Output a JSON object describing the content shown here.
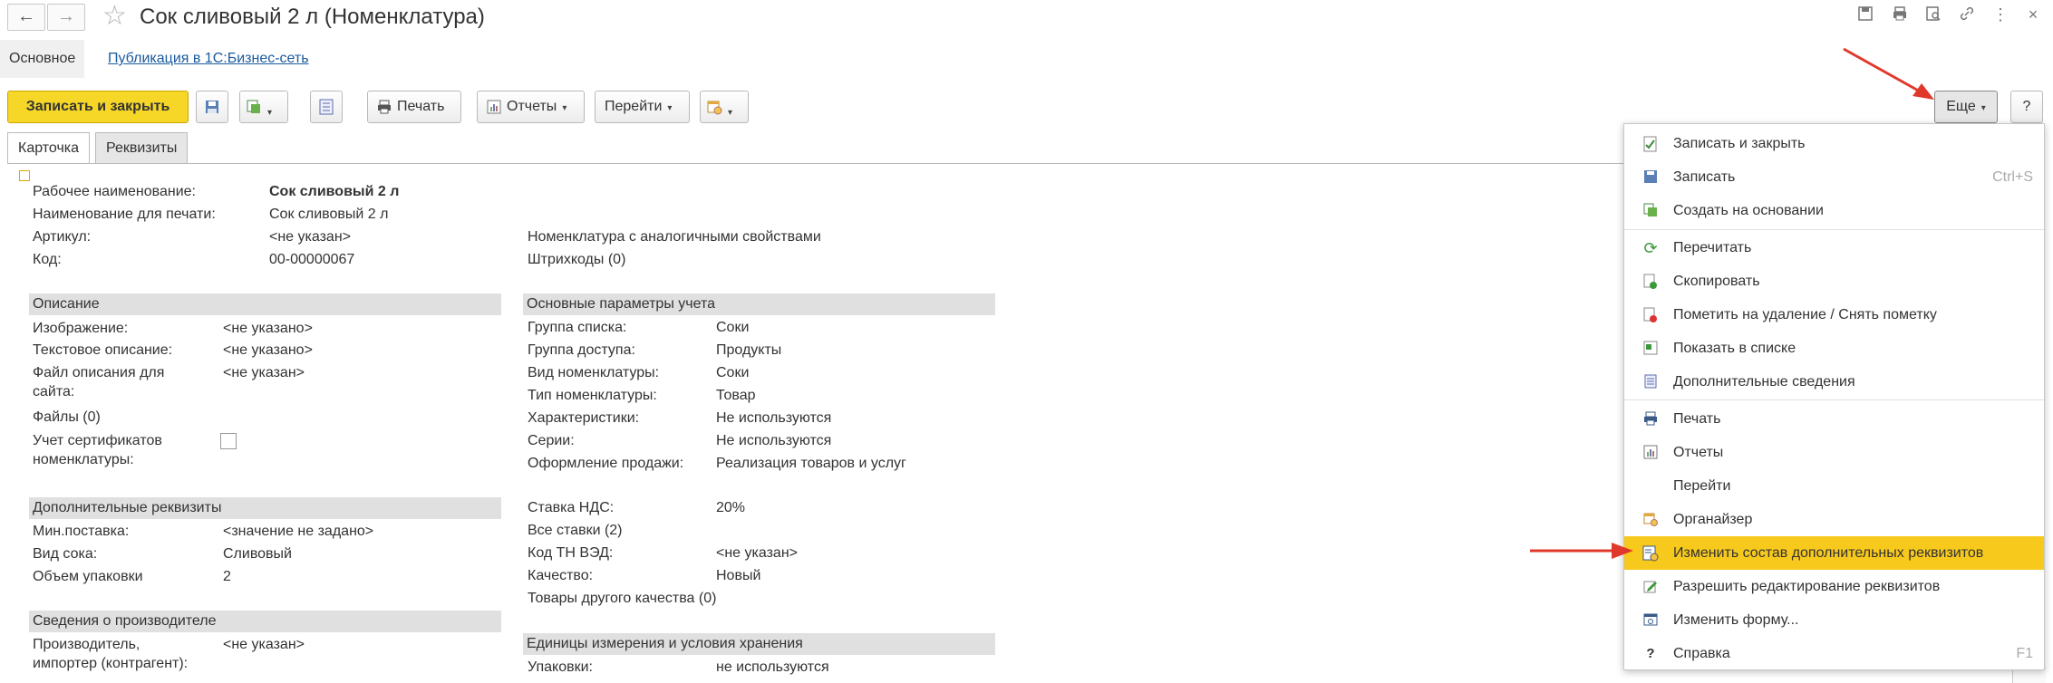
{
  "window": {
    "title": "Сок сливовый 2 л (Номенклатура)",
    "back_icon": "←",
    "forward_icon": "→"
  },
  "subtabs": {
    "main": "Основное",
    "publish": "Публикация в 1С:Бизнес-сеть"
  },
  "toolbar": {
    "save_close": "Записать и закрыть",
    "print": "Печать",
    "reports": "Отчеты",
    "goto": "Перейти",
    "more": "Еще",
    "help": "?"
  },
  "tabs": {
    "card": "Карточка",
    "requisites": "Реквизиты"
  },
  "header_fields": [
    {
      "label": "Рабочее наименование:",
      "value": "Сок сливовый 2 л"
    },
    {
      "label": "Наименование для печати:",
      "value": "Сок сливовый 2 л"
    },
    {
      "label": "Артикул:",
      "value": "<не указан>"
    },
    {
      "label": "Код:",
      "value": "00-00000067"
    }
  ],
  "links_right": {
    "analogs": "Номенклатура с аналогичными свойствами",
    "barcodes": "Штрихкоды (0)"
  },
  "description": {
    "title": "Описание",
    "image_label": "Изображение:",
    "image_value": "<не указано>",
    "text_label": "Текстовое описание:",
    "text_value": "<не указано>",
    "file_label_1": "Файл описания для",
    "file_label_2": "сайта:",
    "file_value": "<не указан>",
    "files_link": "Файлы (0)",
    "cert_label_1": "Учет сертификатов",
    "cert_label_2": "номенклатуры:"
  },
  "extra_requisites": {
    "title": "Дополнительные реквизиты",
    "rows": [
      {
        "label": "Мин.поставка:",
        "value": "<значение не задано>"
      },
      {
        "label": "Вид сока:",
        "value": "Сливовый"
      },
      {
        "label": "Объем упаковки",
        "value": "2"
      }
    ]
  },
  "producer": {
    "title": "Сведения о производителе",
    "label_1": "Производитель,",
    "label_2": "импортер (контрагент):",
    "value": "<не указан>"
  },
  "accounting": {
    "title": "Основные параметры учета",
    "rows": [
      {
        "label": "Группа списка:",
        "value": "Соки"
      },
      {
        "label": "Группа доступа:",
        "value": "Продукты"
      },
      {
        "label": "Вид номенклатуры:",
        "value": "Соки"
      },
      {
        "label": "Тип номенклатуры:",
        "value": "Товар"
      },
      {
        "label": "Характеристики:",
        "value": "Не используются"
      },
      {
        "label": "Серии:",
        "value": "Не используются"
      },
      {
        "label": "Оформление продажи:",
        "value": "Реализация товаров и услуг"
      }
    ],
    "vat_label": "Ставка НДС:",
    "vat_value": "20%",
    "all_rates_link": "Все ставки (2)",
    "tnved_label": "Код ТН ВЭД:",
    "tnved_value": "<не указан>",
    "quality_label": "Качество:",
    "quality_value": "Новый",
    "other_quality_link": "Товары другого качества (0)"
  },
  "units": {
    "title": "Единицы измерения и условия хранения",
    "pack_label": "Упаковки:",
    "pack_value": "не используются"
  },
  "menu": {
    "items": [
      {
        "label": "Записать и закрыть",
        "shortcut": ""
      },
      {
        "label": "Записать",
        "shortcut": "Ctrl+S"
      },
      {
        "label": "Создать на основании",
        "shortcut": ""
      },
      {
        "label": "Перечитать",
        "shortcut": ""
      },
      {
        "label": "Скопировать",
        "shortcut": ""
      },
      {
        "label": "Пометить на удаление / Снять пометку",
        "shortcut": ""
      },
      {
        "label": "Показать в списке",
        "shortcut": ""
      },
      {
        "label": "Дополнительные сведения",
        "shortcut": ""
      },
      {
        "label": "Печать",
        "shortcut": ""
      },
      {
        "label": "Отчеты",
        "shortcut": ""
      },
      {
        "label": "Перейти",
        "shortcut": ""
      },
      {
        "label": "Органайзер",
        "shortcut": ""
      },
      {
        "label": "Изменить состав дополнительных реквизитов",
        "shortcut": ""
      },
      {
        "label": "Разрешить редактирование реквизитов",
        "shortcut": ""
      },
      {
        "label": "Изменить форму...",
        "shortcut": ""
      },
      {
        "label": "Справка",
        "shortcut": "F1"
      }
    ]
  },
  "colors": {
    "accent": "#f6d728",
    "highlight": "#f7c91c",
    "link": "#1a5a9e",
    "arrow": "#e0392b"
  }
}
